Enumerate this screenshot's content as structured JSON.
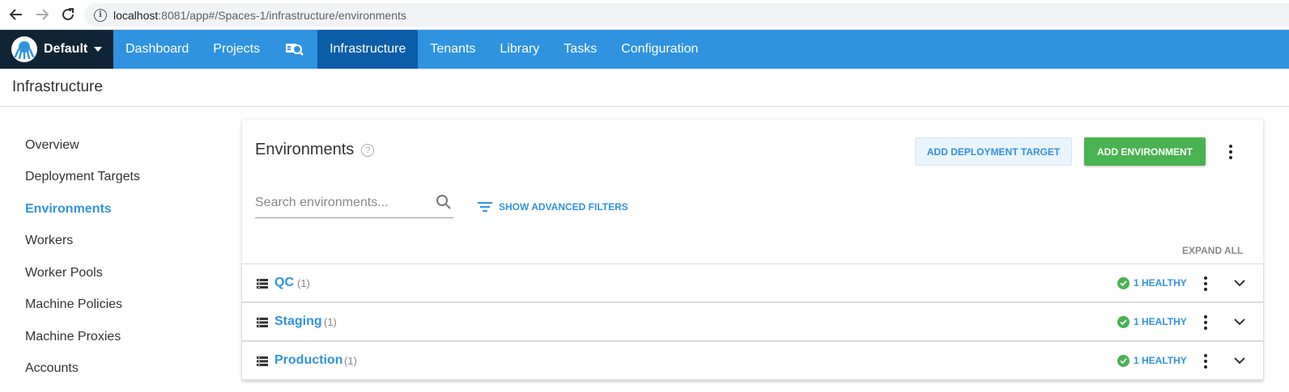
{
  "browser": {
    "url_host": "localhost",
    "url_path": ":8081/app#/Spaces-1/infrastructure/environments"
  },
  "topnav": {
    "space": "Default",
    "items": [
      "Dashboard",
      "Projects",
      "Infrastructure",
      "Tenants",
      "Library",
      "Tasks",
      "Configuration"
    ],
    "active": "Infrastructure",
    "colors": {
      "bar": "#2f93e0",
      "active": "#0b5da8",
      "space_bg": "#0f2535"
    }
  },
  "page": {
    "title": "Infrastructure"
  },
  "sidebar": {
    "items": [
      {
        "label": "Overview"
      },
      {
        "label": "Deployment Targets"
      },
      {
        "label": "Environments",
        "active": true
      },
      {
        "label": "Workers"
      },
      {
        "label": "Worker Pools"
      },
      {
        "label": "Machine Policies"
      },
      {
        "label": "Machine Proxies"
      },
      {
        "label": "Accounts"
      }
    ]
  },
  "main": {
    "title": "Environments",
    "help_icon": "?",
    "add_target_label": "ADD DEPLOYMENT TARGET",
    "add_env_label": "ADD ENVIRONMENT",
    "search_placeholder": "Search environments...",
    "filters_label": "SHOW ADVANCED FILTERS",
    "expand_all": "EXPAND ALL",
    "environments": [
      {
        "name": "QC",
        "count": "(1)",
        "health": "1 HEALTHY"
      },
      {
        "name": "Staging",
        "count": "(1)",
        "health": "1 HEALTHY"
      },
      {
        "name": "Production",
        "count": "(1)",
        "health": "1 HEALTHY"
      }
    ],
    "colors": {
      "accent": "#2f93e0",
      "success": "#48b350"
    }
  }
}
